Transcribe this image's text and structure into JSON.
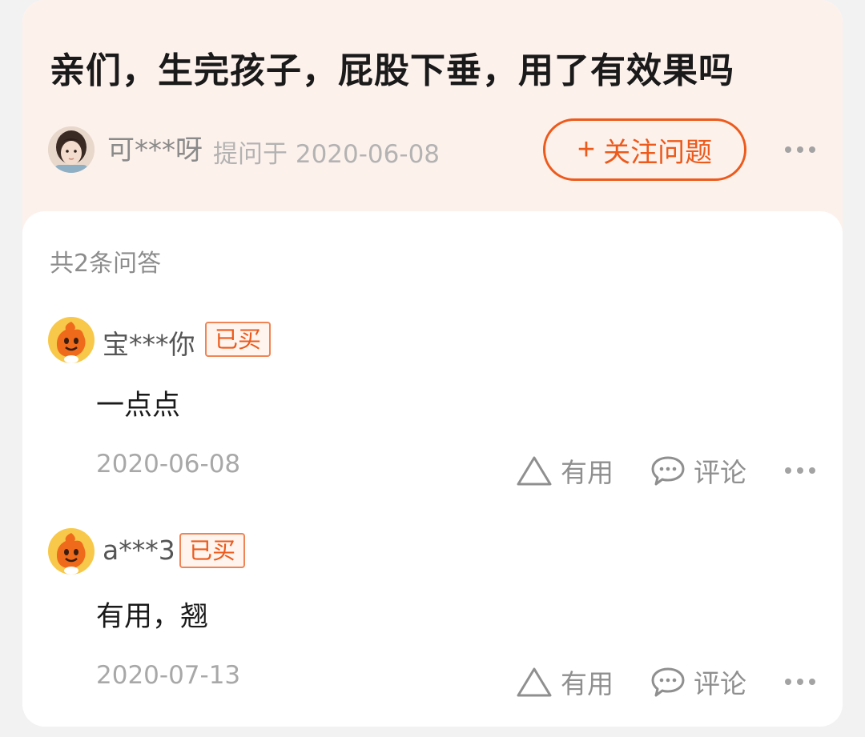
{
  "question": {
    "title": "亲们，生完孩子，屁股下垂，用了有效果吗",
    "asker_name": "可***呀",
    "asked_at": "提问于 2020-06-08",
    "follow_label": "关注问题",
    "follow_icon": "plus-icon",
    "more_icon": "more-dots-icon"
  },
  "answers_header": {
    "count_label": "共2条问答"
  },
  "answers": [
    {
      "user": "宝***你",
      "tag": "已买",
      "text": "一点点",
      "date": "2020-06-08",
      "useful_label": "有用",
      "comment_label": "评论"
    },
    {
      "user": "a***3",
      "tag": "已买",
      "text": "有用，翘",
      "date": "2020-07-13",
      "useful_label": "有用",
      "comment_label": "评论"
    }
  ],
  "colors": {
    "accent": "#ec5a1c",
    "header_bg": "#fdf1ec",
    "muted_text": "#a8a8a8"
  }
}
